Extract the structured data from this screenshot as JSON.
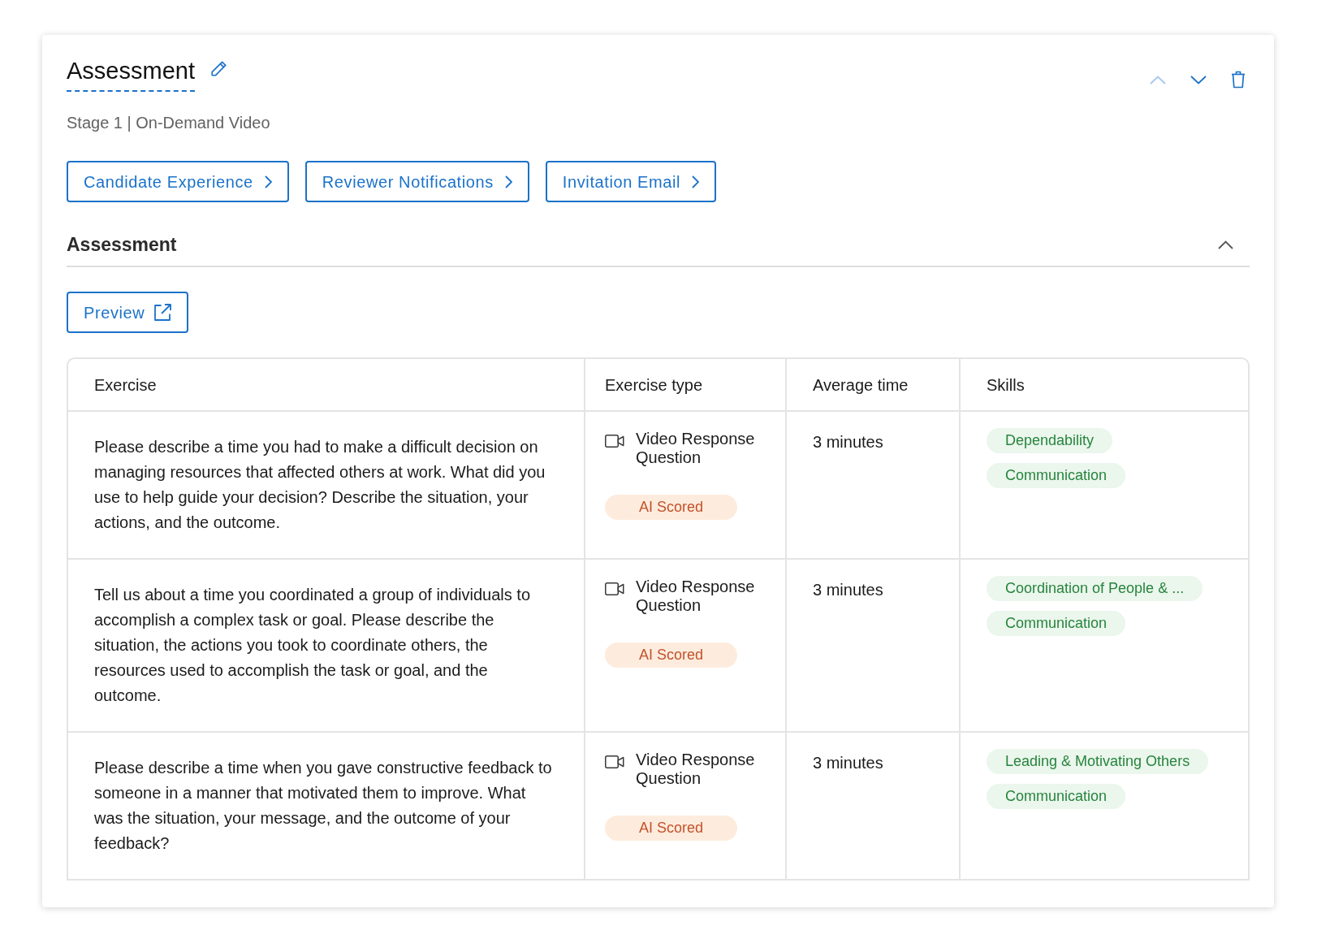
{
  "header": {
    "title": "Assessment",
    "subtitle": "Stage 1 | On-Demand Video",
    "actions": [
      {
        "kind": "move-up",
        "disabled": true
      },
      {
        "kind": "move-down",
        "disabled": false
      },
      {
        "kind": "delete",
        "disabled": false
      }
    ]
  },
  "nav_buttons": [
    "Candidate Experience",
    "Reviewer Notifications",
    "Invitation Email"
  ],
  "section": {
    "title": "Assessment",
    "expanded": true,
    "preview_button": "Preview",
    "table": {
      "columns": [
        "Exercise",
        "Exercise type",
        "Average time",
        "Skills"
      ],
      "rows": [
        {
          "exercise": "Please describe a time you had to make a difficult decision on managing resources that affected others at work. What did you use to help guide your decision? Describe the situation, your actions, and the outcome.",
          "exercise_type": "Video Response Question",
          "badge": "AI Scored",
          "average_time": "3 minutes",
          "skills": [
            "Dependability",
            "Communication"
          ]
        },
        {
          "exercise": "Tell us about a time you coordinated a group of individuals to accomplish a complex task or goal. Please describe the situation, the actions you took to coordinate others, the resources used to accomplish the task or goal, and the outcome.",
          "exercise_type": "Video Response Question",
          "badge": "AI Scored",
          "average_time": "3 minutes",
          "skills": [
            "Coordination of People & ...",
            "Communication"
          ]
        },
        {
          "exercise": "Please describe a time when you gave constructive feedback to someone in a manner that motivated them to improve. What was the situation, your message, and the outcome of your feedback?",
          "exercise_type": "Video Response Question",
          "badge": "AI Scored",
          "average_time": "3 minutes",
          "skills": [
            "Leading & Motivating Others",
            "Communication"
          ]
        }
      ]
    }
  }
}
